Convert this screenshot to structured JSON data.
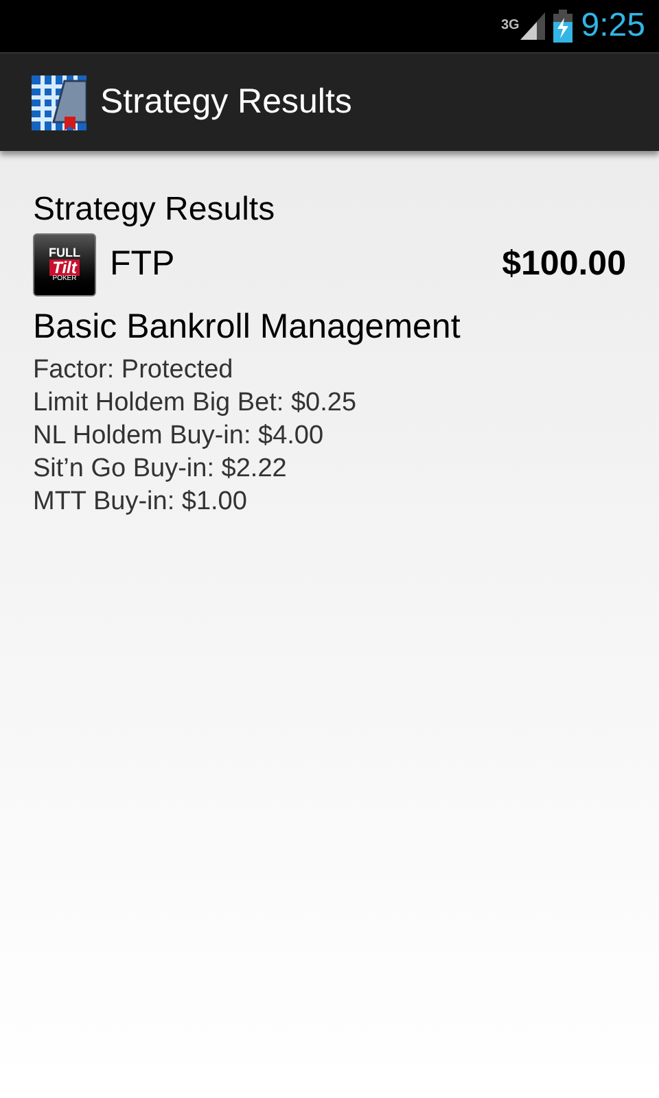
{
  "status_bar": {
    "network": "3G",
    "time": "9:25"
  },
  "action_bar": {
    "title": "Strategy Results"
  },
  "content": {
    "heading": "Strategy Results",
    "site": {
      "logo": {
        "line_1": "FULL",
        "line_2": "Tilt",
        "line_3": "POKER"
      },
      "name": "FTP",
      "bankroll": "$100.00"
    },
    "strategy": "Basic Bankroll Management",
    "details": [
      "Factor: Protected",
      "Limit Holdem Big Bet: $0.25",
      "NL Holdem Buy-in: $4.00",
      "Sit’n Go Buy-in: $2.22",
      "MTT Buy-in: $1.00"
    ]
  }
}
